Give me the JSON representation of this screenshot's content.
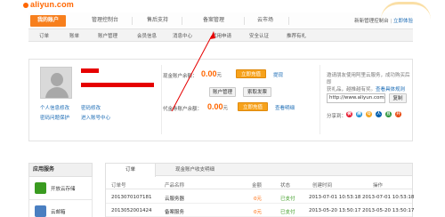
{
  "header": {
    "logo_text": "aliyun.com"
  },
  "main_nav": {
    "items": [
      {
        "label": "我的账户",
        "active": true
      },
      {
        "label": "管理控制台",
        "active": false
      },
      {
        "label": "售后支持",
        "active": false
      },
      {
        "label": "备案管理",
        "active": false
      },
      {
        "label": "云市场",
        "active": false
      }
    ],
    "right_text": "新新管理控制台",
    "right_link": "立即体验"
  },
  "sub_nav": {
    "items": [
      "订单",
      "账单",
      "账户管理",
      "会员信息",
      "消息中心",
      "试用申请",
      "安全认证",
      "推荐有礼"
    ]
  },
  "account": {
    "link_personal": "个人信息修改",
    "link_password": "密码修改",
    "link_enterprise": "密码问题保护",
    "link_enter_center": "进入账号中心",
    "cash_label": "现金账户余额：",
    "cash_amount": "0.00",
    "currency_unit": "元",
    "recharge_button": "立即充值",
    "withdraw_link": "提现",
    "account_manage_button": "账户管理",
    "invoice_button": "索取发票",
    "voucher_label": "代金券账户余额：",
    "voucher_amount": "0.00",
    "voucher_unit": "元",
    "voucher_button": "立即充值",
    "voucher_link": "查看明细"
  },
  "promo": {
    "line1": "邀请朋友使用阿里云服务，成功购买后即",
    "line2": "获礼品，越推越有奖。",
    "link": "查看具体规则",
    "url": "http://www.aliyun.com/cps/ph",
    "copy_button": "复制",
    "share_label": "分享到："
  },
  "share_icons": [
    {
      "name": "weibo-icon",
      "glyph": "微",
      "color": "#e6162d"
    },
    {
      "name": "tencent-icon",
      "glyph": "腾",
      "color": "#1e90d6"
    },
    {
      "name": "qzone-icon",
      "glyph": "Q",
      "color": "#f5a623"
    },
    {
      "name": "renren-icon",
      "glyph": "人",
      "color": "#005eac"
    },
    {
      "name": "douban-icon",
      "glyph": "豆",
      "color": "#2e963d"
    },
    {
      "name": "kaixin-icon",
      "glyph": "开",
      "color": "#e84a10"
    }
  ],
  "services": {
    "heading": "应用服务",
    "items": [
      {
        "label": "开放云存储",
        "color": "#3a9b20"
      },
      {
        "label": "云邮箱",
        "color": "#4a7fc1"
      }
    ]
  },
  "orders": {
    "tabs": [
      "订单",
      "现金账户收支明细"
    ],
    "headers": [
      "订单号",
      "产品名称",
      "金额",
      "状态",
      "创建时间",
      "操作"
    ],
    "rows": [
      {
        "id": "2013070107181",
        "product": "云服务器",
        "amount": "0元",
        "status": "已支付",
        "created": "2013-07-01 10:53:18",
        "action": "2013-07-01 10:53:18"
      },
      {
        "id": "2013052001424",
        "product": "备案服务",
        "amount": "0元",
        "status": "已支付",
        "created": "2013-05-20 13:50:17",
        "action": "2013-05-20 13:50:17"
      }
    ]
  }
}
